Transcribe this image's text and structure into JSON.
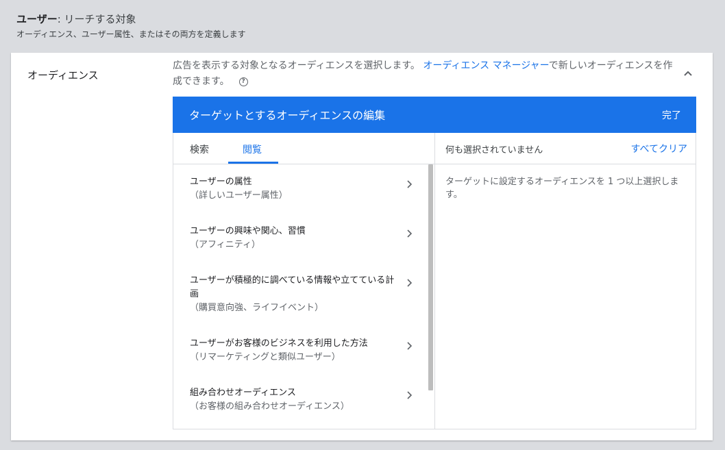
{
  "section": {
    "title_bold": "ユーザー",
    "title_rest": ": リーチする対象",
    "subtitle": "オーディエンス、ユーザー属性、またはその両方を定義します"
  },
  "audience_row": {
    "label": "オーディエンス",
    "description_before": "広告を表示する対象となるオーディエンスを選択します。 ",
    "description_link": "オーディエンス マネージャー",
    "description_after": "で新しいオーディエンスを作成できます。",
    "help_icon": "help-circle-icon",
    "help_glyph": "?",
    "collapse_icon": "chevron-up-icon"
  },
  "editor": {
    "title": "ターゲットとするオーディエンスの編集",
    "done_label": "完了",
    "tabs": [
      {
        "label": "検索",
        "active": false
      },
      {
        "label": "閲覧",
        "active": true
      }
    ],
    "categories": [
      {
        "name": "ユーザーの属性",
        "sub": "（詳しいユーザー属性）"
      },
      {
        "name": "ユーザーの興味や関心、習慣",
        "sub": "（アフィニティ）"
      },
      {
        "name": "ユーザーが積極的に調べている情報や立てている計画",
        "sub": "（購買意向強、ライフイベント）"
      },
      {
        "name": "ユーザーがお客様のビジネスを利用した方法",
        "sub": "（リマーケティングと類似ユーザー）"
      },
      {
        "name": "組み合わせオーディエンス",
        "sub": "（お客様の組み合わせオーディエンス）"
      }
    ],
    "selected_header": "何も選択されていません",
    "clear_all_label": "すべてクリア",
    "hint": "ターゲットに設定するオーディエンスを 1 つ以上選択します。"
  },
  "colors": {
    "accent": "#1a73e8",
    "background": "#dadce0",
    "text_primary": "#202124",
    "text_secondary": "#5f6368"
  }
}
